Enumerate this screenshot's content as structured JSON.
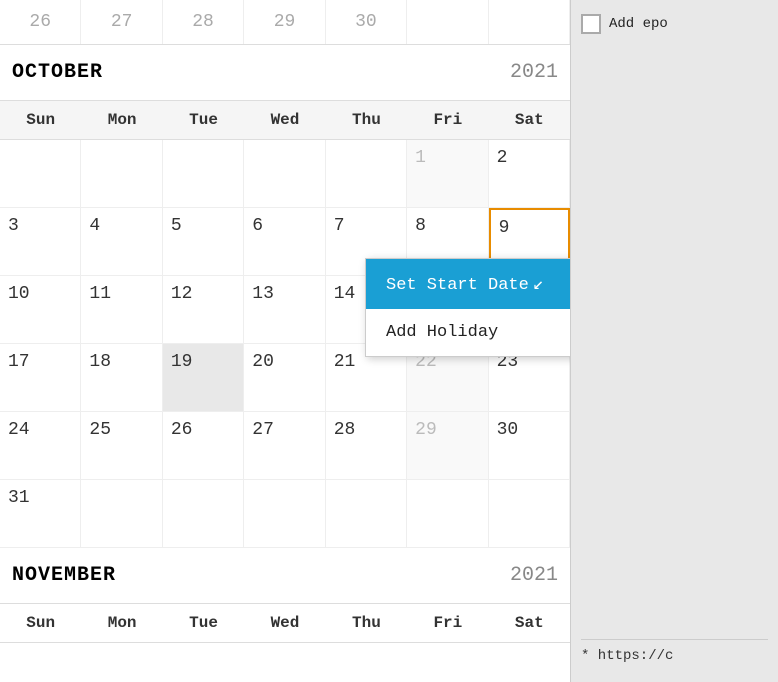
{
  "prevMonthRow": {
    "days": [
      "26",
      "27",
      "28",
      "29",
      "30"
    ]
  },
  "october": {
    "monthName": "OCTOBER",
    "year": "2021",
    "dowHeaders": [
      "Sun",
      "Mon",
      "Tue",
      "Wed",
      "Thu",
      "Fri",
      "Sat"
    ],
    "weeks": [
      [
        {
          "num": "",
          "empty": true
        },
        {
          "num": "",
          "empty": true
        },
        {
          "num": "",
          "empty": true
        },
        {
          "num": "",
          "empty": true
        },
        {
          "num": "",
          "empty": true
        },
        {
          "num": "1",
          "grayed": true
        },
        {
          "num": "2"
        }
      ],
      [
        {
          "num": "3"
        },
        {
          "num": "4"
        },
        {
          "num": "5"
        },
        {
          "num": "6"
        },
        {
          "num": "7"
        },
        {
          "num": "8"
        },
        {
          "num": "9",
          "selectedOrange": true
        }
      ],
      [
        {
          "num": "10"
        },
        {
          "num": "11"
        },
        {
          "num": "12"
        },
        {
          "num": "13"
        },
        {
          "num": "14"
        }
      ],
      [
        {
          "num": "17"
        },
        {
          "num": "18"
        },
        {
          "num": "19",
          "highlighted": true
        },
        {
          "num": "20"
        },
        {
          "num": "21"
        },
        {
          "num": "22",
          "grayed": true
        },
        {
          "num": "23"
        }
      ],
      [
        {
          "num": "24"
        },
        {
          "num": "25"
        },
        {
          "num": "26"
        },
        {
          "num": "27"
        },
        {
          "num": "28"
        },
        {
          "num": "29",
          "grayed": true
        },
        {
          "num": "30"
        }
      ],
      [
        {
          "num": "31"
        },
        {
          "num": "",
          "empty": true
        },
        {
          "num": "",
          "empty": true
        },
        {
          "num": "",
          "empty": true
        },
        {
          "num": "",
          "empty": true
        },
        {
          "num": "",
          "empty": true
        },
        {
          "num": "",
          "empty": true
        }
      ]
    ]
  },
  "contextMenu": {
    "items": [
      {
        "label": "Set Start Date",
        "active": true
      },
      {
        "label": "Add Holiday",
        "active": false
      }
    ]
  },
  "november": {
    "monthName": "NOVEMBER",
    "year": "2021",
    "dowHeaders": [
      "Sun",
      "Mon",
      "Tue",
      "Wed",
      "Thu",
      "Fri",
      "Sat"
    ]
  },
  "sidebar": {
    "addEpochLabel": "Add epo",
    "urlText": "* https://c"
  }
}
